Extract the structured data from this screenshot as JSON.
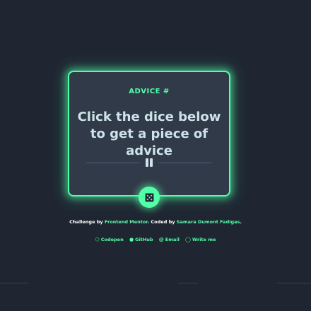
{
  "card": {
    "advice_label": "ADVICE #",
    "quote": "Click the dice below to get a piece of advice"
  },
  "dice_button": {
    "icon": "dice-icon"
  },
  "attribution": {
    "prefix": "Challenge by ",
    "challenge_link": "Frontend Mentor",
    "middle": ". Coded by ",
    "author_link": "Samara Dumont Fadigas",
    "suffix": "."
  },
  "links": [
    {
      "label": "Codepen",
      "icon": "codepen-icon"
    },
    {
      "label": "GitHub",
      "icon": "github-icon"
    },
    {
      "label": "Email",
      "icon": "at-icon"
    },
    {
      "label": "Write me",
      "icon": "whatsapp-icon"
    }
  ],
  "colors": {
    "background": "#1f2632",
    "card": "#313a48",
    "accent": "#52ffa8",
    "text": "#cee3e9"
  }
}
